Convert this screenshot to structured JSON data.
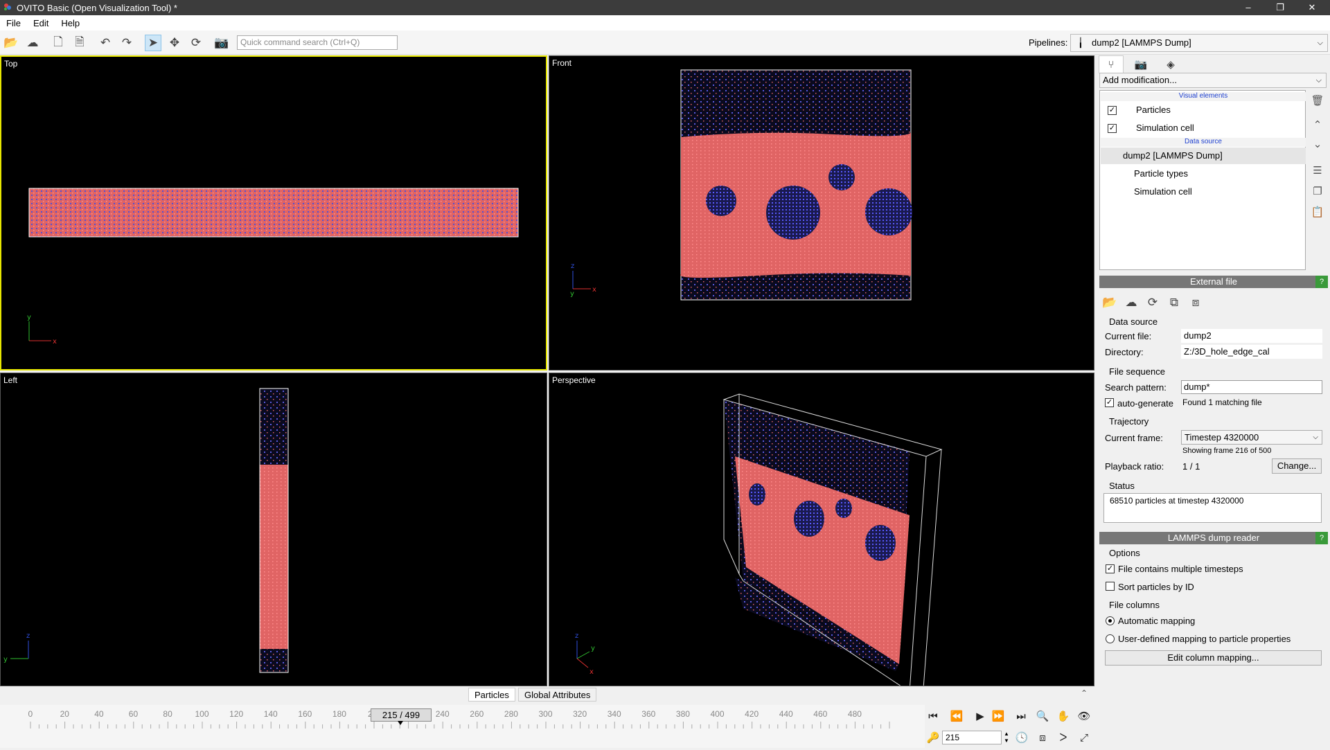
{
  "window": {
    "title": "OVITO Basic (Open Visualization Tool) *",
    "minimize": "–",
    "restore": "❐",
    "close": "✕"
  },
  "menu": [
    "File",
    "Edit",
    "Help"
  ],
  "toolbar": {
    "search_placeholder": "Quick command search (Ctrl+Q)",
    "pipelines_label": "Pipelines:",
    "pipeline_value": "dump2 [LAMMPS Dump]"
  },
  "viewports": {
    "top": "Top",
    "front": "Front",
    "left": "Left",
    "perspective": "Perspective"
  },
  "panel": {
    "add_modification": "Add modification...",
    "visual_header": "Visual elements",
    "visual_items": [
      "Particles",
      "Simulation cell"
    ],
    "datasource_header": "Data source",
    "datasource_items": [
      "dump2 [LAMMPS Dump]",
      "Particle types",
      "Simulation cell"
    ],
    "external_file": {
      "header": "External file",
      "help": "?",
      "data_source_group": "Data source",
      "current_file_label": "Current file:",
      "current_file": "dump2",
      "directory_label": "Directory:",
      "directory": "Z:/3D_hole_edge_cal",
      "file_sequence_group": "File sequence",
      "search_pattern_label": "Search pattern:",
      "search_pattern": "dump*",
      "auto_generate": "auto-generate",
      "found": "Found 1 matching file",
      "trajectory_group": "Trajectory",
      "current_frame_label": "Current frame:",
      "current_frame": "Timestep 4320000",
      "showing": "Showing frame 216 of 500",
      "playback_label": "Playback ratio:",
      "playback": "1 / 1",
      "change": "Change...",
      "status_group": "Status",
      "status": "68510 particles at timestep 4320000"
    },
    "lammps": {
      "header": "LAMMPS dump reader",
      "help": "?",
      "options_group": "Options",
      "multi_timesteps": "File contains multiple timesteps",
      "sort_by_id": "Sort particles by ID",
      "file_columns_group": "File columns",
      "auto_mapping": "Automatic mapping",
      "user_mapping": "User-defined mapping to particle properties",
      "edit_mapping": "Edit column mapping..."
    }
  },
  "bottom_tabs": [
    "Particles",
    "Global Attributes"
  ],
  "timeline": {
    "ticks": [
      "0",
      "20",
      "40",
      "60",
      "80",
      "100",
      "120",
      "140",
      "160",
      "180",
      "2",
      "240",
      "260",
      "280",
      "300",
      "320",
      "340",
      "360",
      "380",
      "400",
      "420",
      "440",
      "460",
      "480"
    ],
    "slider": "215 / 499",
    "current_frame": "215",
    "progress": 0.43
  },
  "colors": {
    "particle_red": "#e06464",
    "particle_blue": "#4a4ad8",
    "active_viewport": "#e6e600"
  }
}
